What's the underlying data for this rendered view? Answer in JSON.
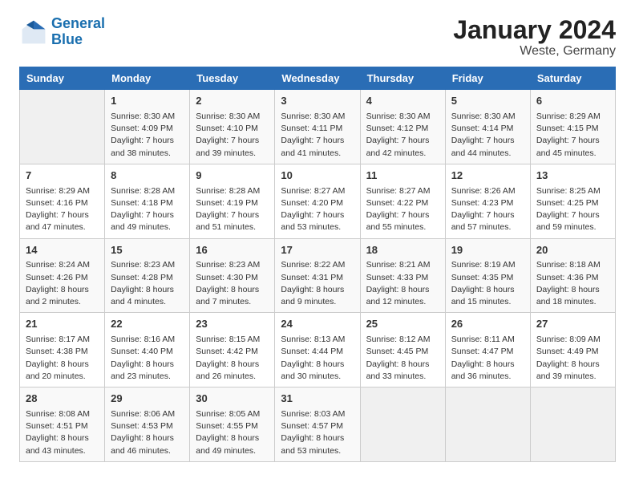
{
  "header": {
    "logo_line1": "General",
    "logo_line2": "Blue",
    "title": "January 2024",
    "subtitle": "Weste, Germany"
  },
  "weekdays": [
    "Sunday",
    "Monday",
    "Tuesday",
    "Wednesday",
    "Thursday",
    "Friday",
    "Saturday"
  ],
  "weeks": [
    [
      {
        "day": "",
        "sunrise": "",
        "sunset": "",
        "daylight": ""
      },
      {
        "day": "1",
        "sunrise": "Sunrise: 8:30 AM",
        "sunset": "Sunset: 4:09 PM",
        "daylight": "Daylight: 7 hours and 38 minutes."
      },
      {
        "day": "2",
        "sunrise": "Sunrise: 8:30 AM",
        "sunset": "Sunset: 4:10 PM",
        "daylight": "Daylight: 7 hours and 39 minutes."
      },
      {
        "day": "3",
        "sunrise": "Sunrise: 8:30 AM",
        "sunset": "Sunset: 4:11 PM",
        "daylight": "Daylight: 7 hours and 41 minutes."
      },
      {
        "day": "4",
        "sunrise": "Sunrise: 8:30 AM",
        "sunset": "Sunset: 4:12 PM",
        "daylight": "Daylight: 7 hours and 42 minutes."
      },
      {
        "day": "5",
        "sunrise": "Sunrise: 8:30 AM",
        "sunset": "Sunset: 4:14 PM",
        "daylight": "Daylight: 7 hours and 44 minutes."
      },
      {
        "day": "6",
        "sunrise": "Sunrise: 8:29 AM",
        "sunset": "Sunset: 4:15 PM",
        "daylight": "Daylight: 7 hours and 45 minutes."
      }
    ],
    [
      {
        "day": "7",
        "sunrise": "Sunrise: 8:29 AM",
        "sunset": "Sunset: 4:16 PM",
        "daylight": "Daylight: 7 hours and 47 minutes."
      },
      {
        "day": "8",
        "sunrise": "Sunrise: 8:28 AM",
        "sunset": "Sunset: 4:18 PM",
        "daylight": "Daylight: 7 hours and 49 minutes."
      },
      {
        "day": "9",
        "sunrise": "Sunrise: 8:28 AM",
        "sunset": "Sunset: 4:19 PM",
        "daylight": "Daylight: 7 hours and 51 minutes."
      },
      {
        "day": "10",
        "sunrise": "Sunrise: 8:27 AM",
        "sunset": "Sunset: 4:20 PM",
        "daylight": "Daylight: 7 hours and 53 minutes."
      },
      {
        "day": "11",
        "sunrise": "Sunrise: 8:27 AM",
        "sunset": "Sunset: 4:22 PM",
        "daylight": "Daylight: 7 hours and 55 minutes."
      },
      {
        "day": "12",
        "sunrise": "Sunrise: 8:26 AM",
        "sunset": "Sunset: 4:23 PM",
        "daylight": "Daylight: 7 hours and 57 minutes."
      },
      {
        "day": "13",
        "sunrise": "Sunrise: 8:25 AM",
        "sunset": "Sunset: 4:25 PM",
        "daylight": "Daylight: 7 hours and 59 minutes."
      }
    ],
    [
      {
        "day": "14",
        "sunrise": "Sunrise: 8:24 AM",
        "sunset": "Sunset: 4:26 PM",
        "daylight": "Daylight: 8 hours and 2 minutes."
      },
      {
        "day": "15",
        "sunrise": "Sunrise: 8:23 AM",
        "sunset": "Sunset: 4:28 PM",
        "daylight": "Daylight: 8 hours and 4 minutes."
      },
      {
        "day": "16",
        "sunrise": "Sunrise: 8:23 AM",
        "sunset": "Sunset: 4:30 PM",
        "daylight": "Daylight: 8 hours and 7 minutes."
      },
      {
        "day": "17",
        "sunrise": "Sunrise: 8:22 AM",
        "sunset": "Sunset: 4:31 PM",
        "daylight": "Daylight: 8 hours and 9 minutes."
      },
      {
        "day": "18",
        "sunrise": "Sunrise: 8:21 AM",
        "sunset": "Sunset: 4:33 PM",
        "daylight": "Daylight: 8 hours and 12 minutes."
      },
      {
        "day": "19",
        "sunrise": "Sunrise: 8:19 AM",
        "sunset": "Sunset: 4:35 PM",
        "daylight": "Daylight: 8 hours and 15 minutes."
      },
      {
        "day": "20",
        "sunrise": "Sunrise: 8:18 AM",
        "sunset": "Sunset: 4:36 PM",
        "daylight": "Daylight: 8 hours and 18 minutes."
      }
    ],
    [
      {
        "day": "21",
        "sunrise": "Sunrise: 8:17 AM",
        "sunset": "Sunset: 4:38 PM",
        "daylight": "Daylight: 8 hours and 20 minutes."
      },
      {
        "day": "22",
        "sunrise": "Sunrise: 8:16 AM",
        "sunset": "Sunset: 4:40 PM",
        "daylight": "Daylight: 8 hours and 23 minutes."
      },
      {
        "day": "23",
        "sunrise": "Sunrise: 8:15 AM",
        "sunset": "Sunset: 4:42 PM",
        "daylight": "Daylight: 8 hours and 26 minutes."
      },
      {
        "day": "24",
        "sunrise": "Sunrise: 8:13 AM",
        "sunset": "Sunset: 4:44 PM",
        "daylight": "Daylight: 8 hours and 30 minutes."
      },
      {
        "day": "25",
        "sunrise": "Sunrise: 8:12 AM",
        "sunset": "Sunset: 4:45 PM",
        "daylight": "Daylight: 8 hours and 33 minutes."
      },
      {
        "day": "26",
        "sunrise": "Sunrise: 8:11 AM",
        "sunset": "Sunset: 4:47 PM",
        "daylight": "Daylight: 8 hours and 36 minutes."
      },
      {
        "day": "27",
        "sunrise": "Sunrise: 8:09 AM",
        "sunset": "Sunset: 4:49 PM",
        "daylight": "Daylight: 8 hours and 39 minutes."
      }
    ],
    [
      {
        "day": "28",
        "sunrise": "Sunrise: 8:08 AM",
        "sunset": "Sunset: 4:51 PM",
        "daylight": "Daylight: 8 hours and 43 minutes."
      },
      {
        "day": "29",
        "sunrise": "Sunrise: 8:06 AM",
        "sunset": "Sunset: 4:53 PM",
        "daylight": "Daylight: 8 hours and 46 minutes."
      },
      {
        "day": "30",
        "sunrise": "Sunrise: 8:05 AM",
        "sunset": "Sunset: 4:55 PM",
        "daylight": "Daylight: 8 hours and 49 minutes."
      },
      {
        "day": "31",
        "sunrise": "Sunrise: 8:03 AM",
        "sunset": "Sunset: 4:57 PM",
        "daylight": "Daylight: 8 hours and 53 minutes."
      },
      {
        "day": "",
        "sunrise": "",
        "sunset": "",
        "daylight": ""
      },
      {
        "day": "",
        "sunrise": "",
        "sunset": "",
        "daylight": ""
      },
      {
        "day": "",
        "sunrise": "",
        "sunset": "",
        "daylight": ""
      }
    ]
  ]
}
